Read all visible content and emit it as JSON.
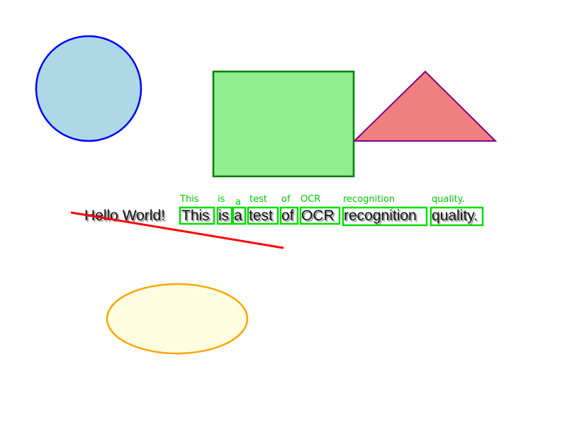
{
  "colors": {
    "background": "#ffffff",
    "circle_fill": "#add8e6",
    "circle_stroke": "#0000ff",
    "rect_fill": "#90ee90",
    "rect_stroke": "#008000",
    "triangle_fill": "#f08080",
    "triangle_stroke": "#800080",
    "line_stroke": "#ff0000",
    "ellipse_fill": "#fffee0",
    "ellipse_stroke": "#ffa500",
    "ocr_box": "#00dd00",
    "ocr_label": "#00cc00",
    "text": "#111111"
  },
  "main_text": {
    "greeting": "Hello World!",
    "words": [
      "This",
      "is",
      "a",
      "test",
      "of",
      "OCR",
      "recognition",
      "quality."
    ]
  },
  "ocr_labels": [
    "This",
    "is",
    "a",
    "test",
    "of",
    "OCR",
    "recognition",
    "quality."
  ]
}
